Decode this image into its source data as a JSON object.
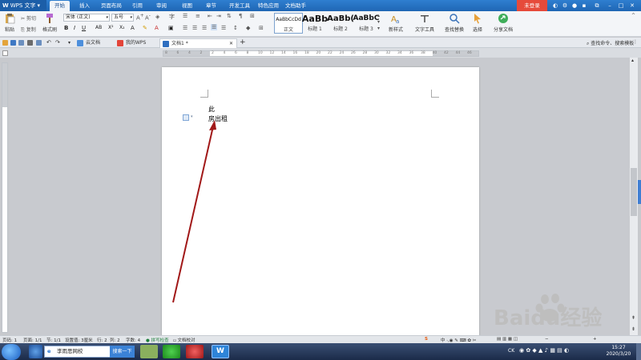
{
  "titlebar": {
    "app_name": "WPS 文字",
    "tabs": [
      "开始",
      "插入",
      "页面布局",
      "引用",
      "审阅",
      "视图",
      "章节",
      "开发工具",
      "特色应用",
      "文档助手"
    ],
    "login_label": "未登录",
    "accent_color": "#1f66b4"
  },
  "ribbon": {
    "paste_label": "粘贴",
    "cut_label": "剪切",
    "copy_label": "复制",
    "format_painter_label": "格式刷",
    "font_name": "宋体 (正文)",
    "font_size": "五号",
    "styles": [
      {
        "sample": "AaBbCcDd",
        "caption": "正文"
      },
      {
        "sample": "AaBb",
        "caption": "标题 1"
      },
      {
        "sample": "AaBb(",
        "caption": "标题 2"
      },
      {
        "sample": "AaBbC",
        "caption": "标题 3"
      }
    ],
    "new_style_label": "新样式",
    "text_tools_label": "文字工具",
    "find_replace_label": "查找替换",
    "select_label": "选择",
    "share_label": "分享文档"
  },
  "tabstrip": {
    "tabs": [
      "云文档",
      "我的WPS",
      "文档1 *"
    ],
    "add_tab": "+",
    "search_cmd": "查找命令、搜索模板"
  },
  "ruler_numbers": [
    "8",
    "6",
    "4",
    "2",
    "2",
    "4",
    "6",
    "8",
    "10",
    "12",
    "14",
    "16",
    "18",
    "20",
    "22",
    "24",
    "26",
    "28",
    "30",
    "32",
    "34",
    "36",
    "38",
    "40",
    "42",
    "44",
    "46"
  ],
  "document": {
    "line1": "此",
    "line2": "房出租"
  },
  "statusbar": {
    "items": [
      "页码: 1",
      "页面: 1/1",
      "节: 1/1",
      "设置值: 3厘米",
      "行: 2",
      "列: 2",
      "字数: 4",
      "拼写检查",
      "文档校对"
    ]
  },
  "taskbar": {
    "search_text": "李雨思网校",
    "search_button": "搜索一下",
    "lang": "CK",
    "time": "15:27",
    "date": "2020/3/20"
  },
  "watermark": {
    "text": "Baidu经验"
  }
}
